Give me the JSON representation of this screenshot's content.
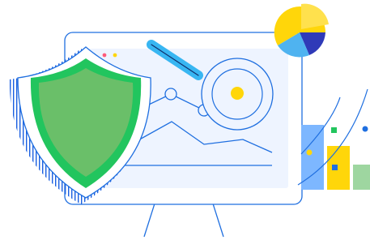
{
  "illustration": {
    "kind": "security-analytics-illustration",
    "text": []
  },
  "colors": {
    "outline_blue": "#1f6fe0",
    "panel_fill": "#eef4ff",
    "monitor_fill": "#ffffff",
    "hatch_blue": "#1a5fe0",
    "shield_green_outer": "#22c55e",
    "shield_green_inner": "#6abf69",
    "magnifier_handle": "#38b6f2",
    "target_yellow": "#ffd60a",
    "bar_blue": "#7db7ff",
    "bar_yellow": "#ffd60a",
    "bar_green": "#9ed6a0",
    "pie_yellow": "#ffd60a",
    "pie_navy": "#2f3ab8",
    "pie_blue": "#2a7de1",
    "pie_light_blue": "#4fb3f0",
    "dot_pink": "#ff5a7a",
    "dot_red": "#ff3b5c",
    "dot_yellow": "#ffd60a",
    "marker_green": "#22c55e"
  },
  "icons": [
    "monitor-icon",
    "shield-icon",
    "magnifier-icon",
    "pie-chart-icon",
    "bar-chart-icon",
    "line-chart-icon"
  ]
}
